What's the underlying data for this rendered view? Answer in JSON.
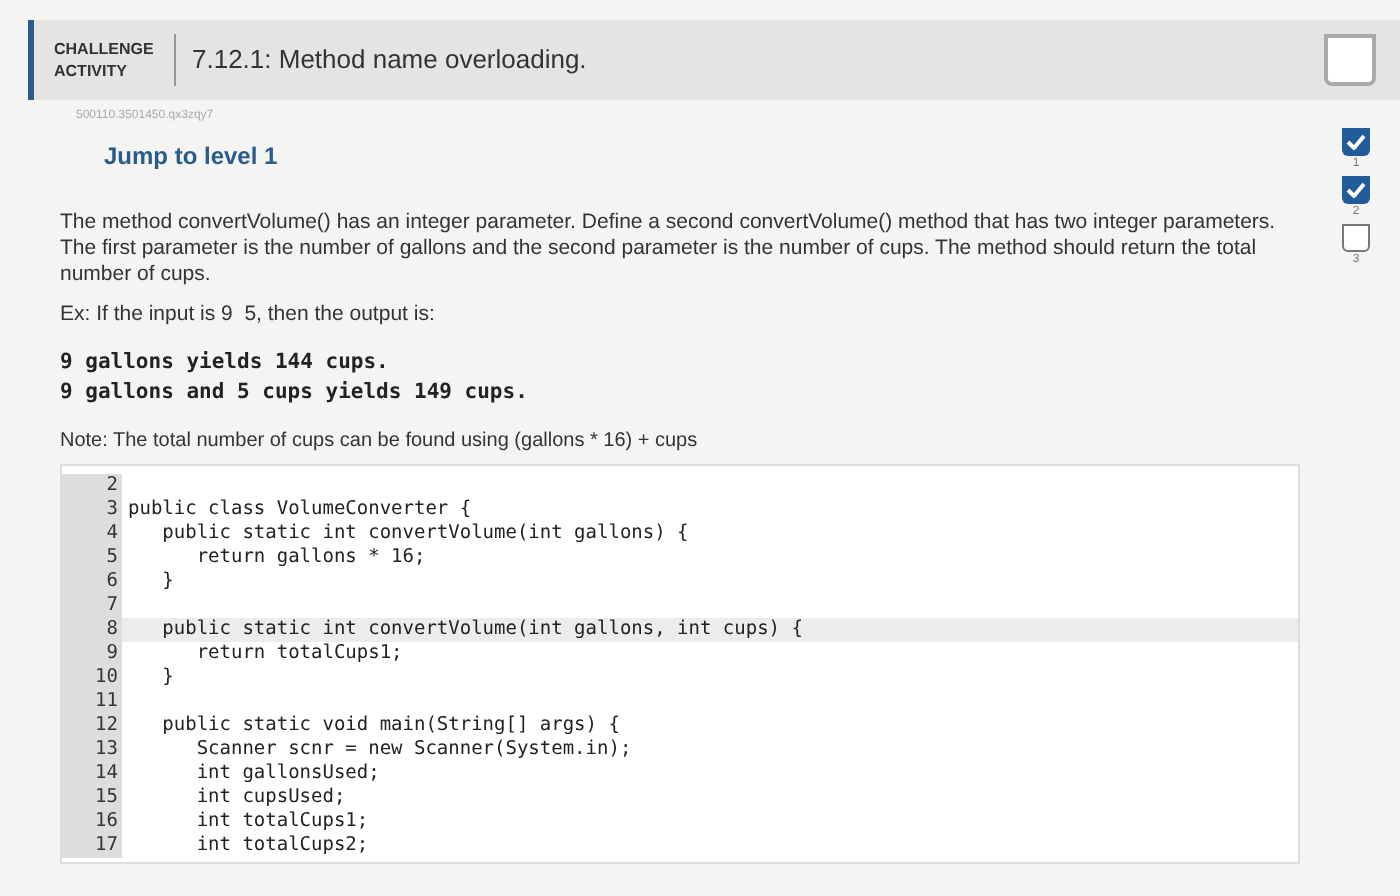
{
  "header": {
    "badge": "CHALLENGE ACTIVITY",
    "title": "7.12.1: Method name overloading."
  },
  "activity_id": "500110.3501450.qx3zqy7",
  "jump_link": "Jump to level 1",
  "levels": [
    {
      "number": "1",
      "checked": true
    },
    {
      "number": "2",
      "checked": true
    },
    {
      "number": "3",
      "checked": false
    }
  ],
  "instructions": "The method convertVolume() has an integer parameter. Define a second convertVolume() method that has two integer parameters. The first parameter is the number of gallons and the second parameter is the number of cups. The method should return the total number of cups.",
  "example_intro": "Ex: If the input is 9  5, then the output is:",
  "example_output": [
    "9 gallons yields 144 cups.",
    "9 gallons and 5 cups yields 149 cups."
  ],
  "note": "Note: The total number of cups can be found using (gallons * 16) + cups",
  "code_lines": [
    {
      "number": "2",
      "highlighted": false
    },
    {
      "number": "3",
      "code": "public class VolumeConverter {",
      "highlighted": false
    },
    {
      "number": "4",
      "code": "   public static int convertVolume(int gallons) {",
      "highlighted": false
    },
    {
      "number": "5",
      "code": "      return gallons * 16;",
      "highlighted": false
    },
    {
      "number": "6",
      "code": "   }",
      "highlighted": false
    },
    {
      "number": "7",
      "highlighted": false
    },
    {
      "number": "8",
      "code": "   public static int convertVolume(int gallons, int cups) {",
      "highlighted": true
    },
    {
      "number": "9",
      "code": "      return totalCups1;",
      "highlighted": false
    },
    {
      "number": "10",
      "code": "   }",
      "highlighted": false
    },
    {
      "number": "11",
      "highlighted": false
    },
    {
      "number": "12",
      "code": "   public static void main(String[] args) {",
      "highlighted": false
    },
    {
      "number": "13",
      "code": "      Scanner scnr = new Scanner(System.in);",
      "highlighted": false
    },
    {
      "number": "14",
      "code": "      int gallonsUsed;",
      "highlighted": false
    },
    {
      "number": "15",
      "code": "      int cupsUsed;",
      "highlighted": false
    },
    {
      "number": "16",
      "code": "      int totalCups1;",
      "highlighted": false
    },
    {
      "number": "17",
      "code": "      int totalCups2;",
      "highlighted": false
    }
  ]
}
